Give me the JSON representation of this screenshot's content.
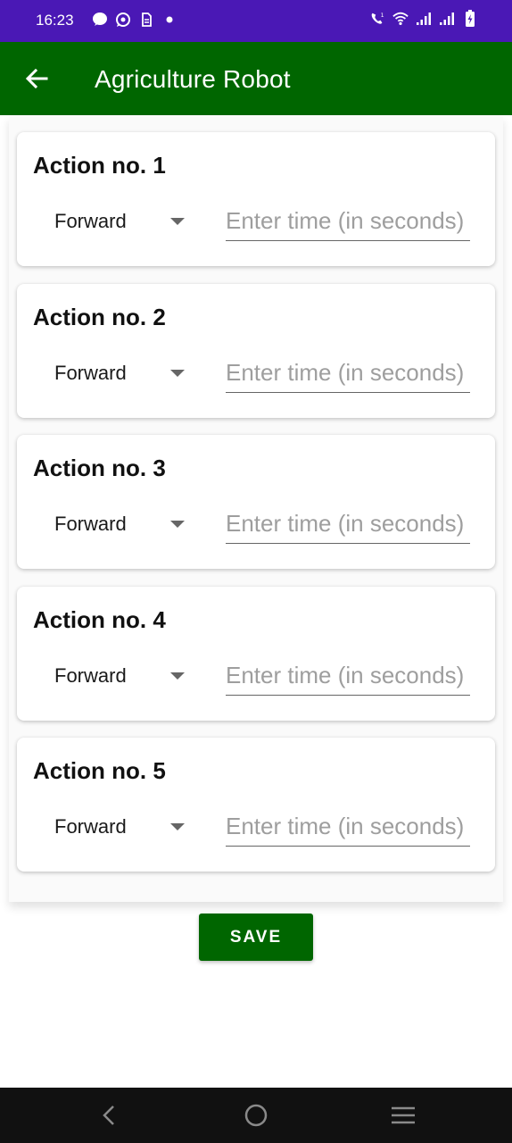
{
  "status_bar": {
    "time": "16:23",
    "left_icons": [
      "message-icon",
      "whatsapp-icon",
      "sim-icon",
      "dot-icon"
    ],
    "right_icons": [
      "volte-call-icon",
      "wifi-icon",
      "signal-icon-1",
      "signal-icon-2",
      "battery-charging-icon"
    ],
    "background": "#4a18b5"
  },
  "app_bar": {
    "title": "Agriculture Robot",
    "background": "#006600"
  },
  "actions": [
    {
      "title": "Action no. 1",
      "direction": "Forward",
      "time_placeholder": "Enter time (in seconds)",
      "time_value": ""
    },
    {
      "title": "Action no. 2",
      "direction": "Forward",
      "time_placeholder": "Enter time (in seconds)",
      "time_value": ""
    },
    {
      "title": "Action no. 3",
      "direction": "Forward",
      "time_placeholder": "Enter time (in seconds)",
      "time_value": ""
    },
    {
      "title": "Action no. 4",
      "direction": "Forward",
      "time_placeholder": "Enter time (in seconds)",
      "time_value": ""
    },
    {
      "title": "Action no. 5",
      "direction": "Forward",
      "time_placeholder": "Enter time (in seconds)",
      "time_value": ""
    }
  ],
  "save_button": {
    "label": "SAVE"
  },
  "nav_bar": {
    "icons": [
      "back-nav-icon",
      "home-nav-icon",
      "recents-nav-icon"
    ]
  }
}
